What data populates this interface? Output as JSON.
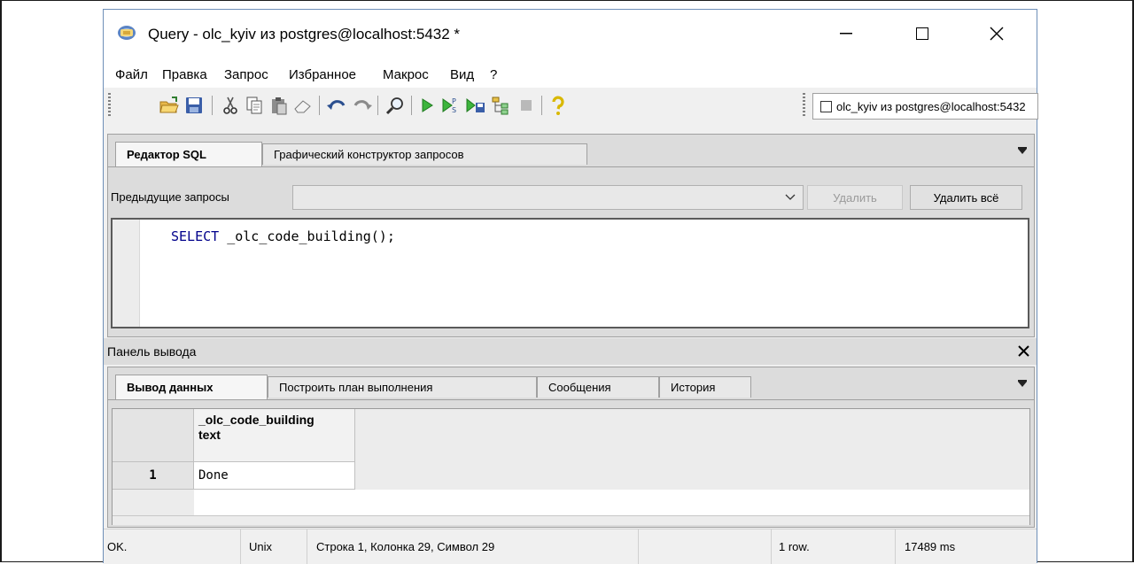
{
  "window": {
    "title": "Query - olc_kyiv из postgres@localhost:5432 *",
    "minimize_glyph": "—",
    "maximize_glyph": "☐",
    "close_glyph": "✕"
  },
  "menu": {
    "items": [
      "Файл",
      "Правка",
      "Запрос",
      "Избранное",
      "Макрос",
      "Вид",
      "?"
    ]
  },
  "toolbar": {
    "icons": [
      "open-folder-icon",
      "save-icon",
      "cut-icon",
      "copy-icon",
      "paste-icon",
      "eraser-icon",
      "undo-icon",
      "redo-icon",
      "find-icon",
      "execute-icon",
      "execute-pgscript-icon",
      "execute-to-file-icon",
      "explain-icon",
      "stop-icon",
      "help-icon"
    ],
    "connection": "olc_kyiv из postgres@localhost:5432"
  },
  "sql_panel": {
    "tabs": [
      "Редактор SQL",
      "Графический конструктор запросов"
    ],
    "previous_label": "Предыдущие запросы",
    "previous_value": "",
    "delete_label": "Удалить",
    "delete_all_label": "Удалить всё",
    "code_keyword": "SELECT",
    "code_rest": " _olc_code_building();"
  },
  "output_panel": {
    "title": "Панель вывода",
    "close_glyph": "✕",
    "tabs": [
      "Вывод данных",
      "Построить план выполнения",
      "Сообщения",
      "История"
    ],
    "column_name": "_olc_code_building",
    "column_type": "text",
    "rows": [
      {
        "num": "1",
        "value": "Done"
      }
    ]
  },
  "status": {
    "state": "OK.",
    "line_ending": "Unix",
    "position": "Строка 1, Колонка 29, Символ 29",
    "rows": "1 row.",
    "time": "17489 ms"
  },
  "colors": {
    "keyword": "#00008b",
    "window_border": "#6e8fb8"
  }
}
